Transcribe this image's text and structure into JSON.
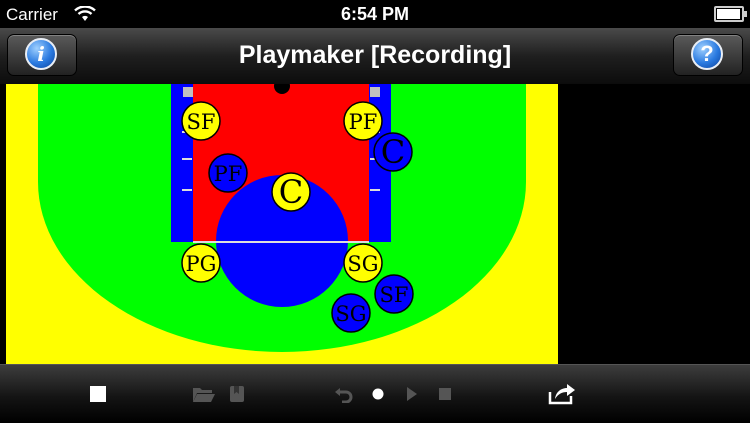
{
  "status_bar": {
    "carrier": "Carrier",
    "time": "6:54 PM",
    "battery_level": 0.95
  },
  "navbar": {
    "title": "Playmaker [Recording]",
    "info_button": "i",
    "help_button": "?"
  },
  "court": {
    "colors": {
      "outside": "#ffff00",
      "three_point_area": "#00ff00",
      "lane_border": "#0000ff",
      "paint": "#ff0000",
      "center_circle": "#0000ff",
      "yellow_team": "#ffff00",
      "blue_team": "#0000ff"
    },
    "yellow_players": [
      {
        "label": "SF"
      },
      {
        "label": "PF"
      },
      {
        "label": "C"
      },
      {
        "label": "PG"
      },
      {
        "label": "SG"
      }
    ],
    "blue_players": [
      {
        "label": "PF"
      },
      {
        "label": "C"
      },
      {
        "label": "SF"
      },
      {
        "label": "SG"
      }
    ]
  },
  "toolbar": {
    "icons": [
      "stop-icon",
      "folder-icon",
      "bookmark-icon",
      "undo-icon",
      "record-dot-icon",
      "play-icon",
      "stop-playback-icon",
      "share-icon"
    ]
  }
}
